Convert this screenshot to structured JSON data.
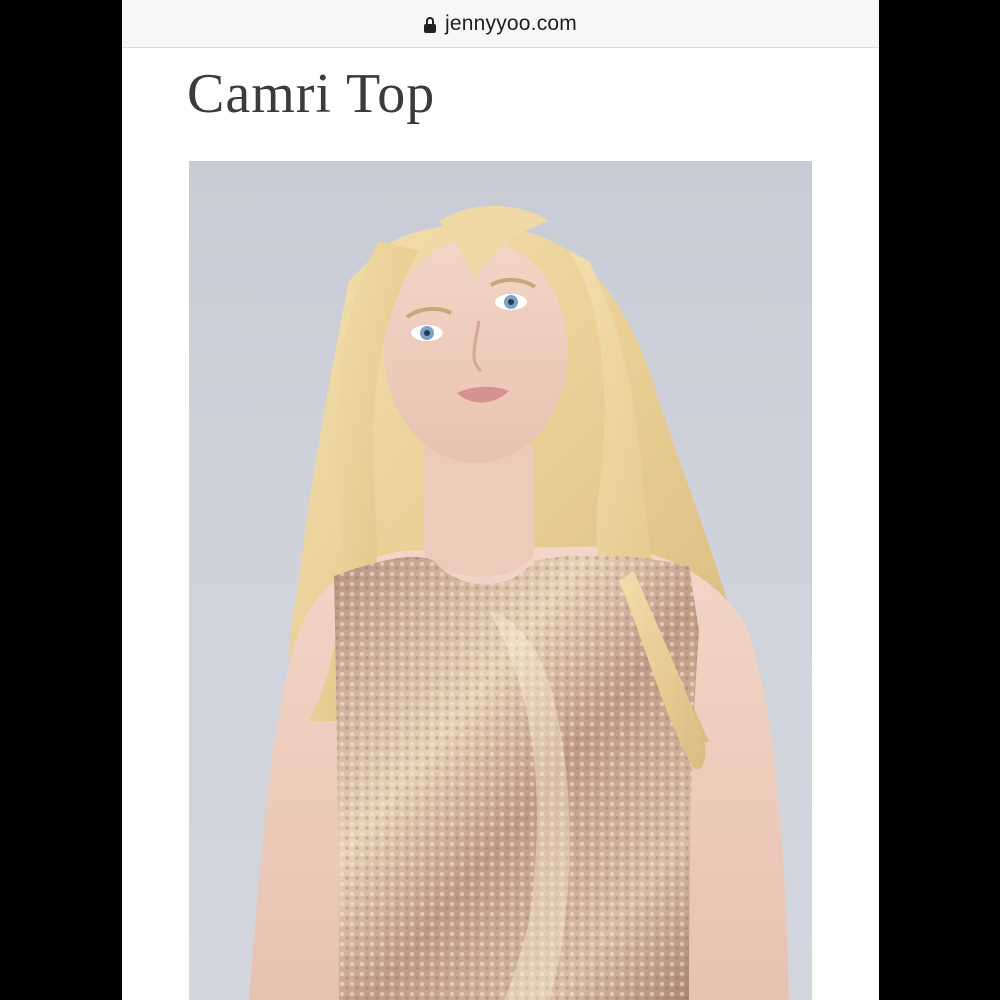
{
  "browser": {
    "url": "jennyyoo.com",
    "lock_icon": "lock-icon"
  },
  "product": {
    "title": "Camri Top",
    "image_alt": "Model wearing sequined Camri Top"
  },
  "colors": {
    "page_background": "#ffffff",
    "title_color": "#3b3b3b",
    "photo_background": "#cfd2db"
  }
}
